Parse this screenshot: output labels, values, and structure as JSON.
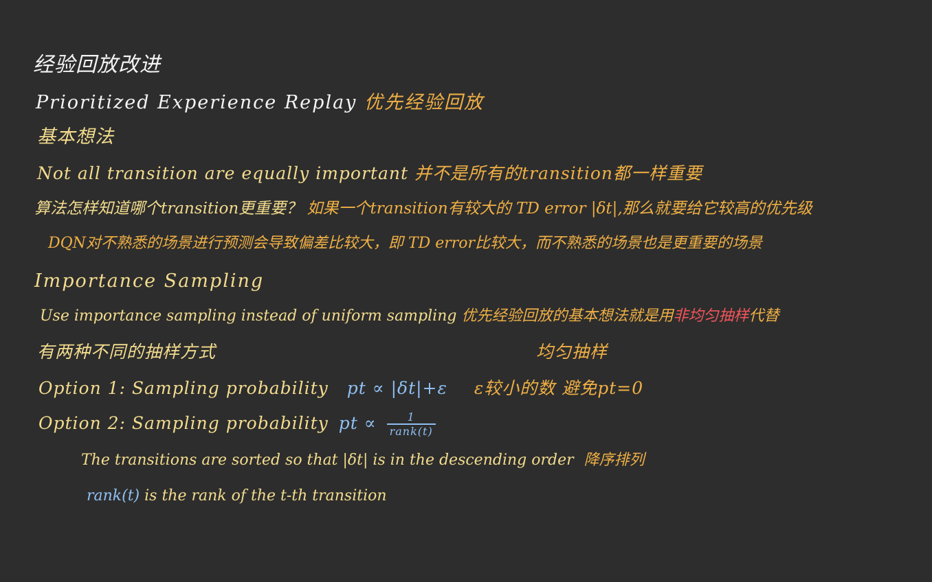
{
  "notes": {
    "title": "经验回放改进",
    "per_heading": "Prioritized Experience Replay",
    "per_heading_cn": "优先经验回放",
    "basic_idea": "基本想法",
    "l1_en": "Not all transition are equally important",
    "l1_cn": "并不是所有的transition都一样重要",
    "l2": "算法怎样知道哪个transition更重要？",
    "l2_cont": "如果一个transition有较大的 TD error |δt|,那么就要给它较高的优先级",
    "l3": "DQN对不熟悉的场景进行预测会导致偏差比较大，即 TD error比较大，而不熟悉的场景也是更重要的场景",
    "importance_heading": "Importance Sampling",
    "l4_en": "Use importance sampling instead of uniform sampling",
    "l4_cn_a": "优先经验回放的基本想法就是用",
    "l4_cn_red": "非均匀抽样",
    "l4_cn_b": "代替",
    "l4_cn_c": "均匀抽样",
    "l5": "有两种不同的抽样方式",
    "opt1_label": "Option 1: Sampling probability",
    "opt1_formula": "pt ∝ |δt|+ε",
    "opt1_note": "ε较小的数 避免pt=0",
    "opt2_label": "Option 2: Sampling probability",
    "opt2_p": "pt ∝",
    "opt2_num": "1",
    "opt2_den": "rank(t)",
    "l6_en": "The transitions are sorted so that |δt| is in the descending order",
    "l6_cn": "降序排列",
    "l7_a": "rank(t)",
    "l7_b": "is the rank of the t-th transition"
  },
  "colors": {
    "background": "#2d2d2d",
    "white_ink": "#f4f4f4",
    "yellow_ink": "#f3dc8e",
    "orange_ink": "#f0b045",
    "blue_ink": "#8fc0f4",
    "red_ink": "#f2555a"
  }
}
